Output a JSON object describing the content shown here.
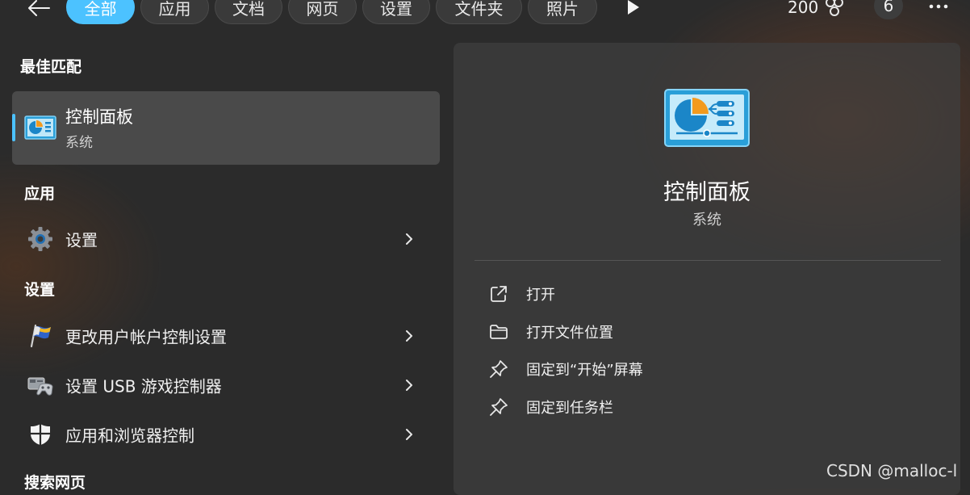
{
  "filters": [
    "全部",
    "应用",
    "文档",
    "网页",
    "设置",
    "文件夹",
    "照片"
  ],
  "header": {
    "points": "200",
    "badge_count": "6"
  },
  "sections": {
    "best_match": "最佳匹配",
    "apps": "应用",
    "settings": "设置",
    "web": "搜索网页"
  },
  "best_match": {
    "title": "控制面板",
    "subtitle": "系统",
    "icon": "control-panel-icon"
  },
  "apps": [
    {
      "label": "设置",
      "icon": "gear-icon"
    }
  ],
  "settings": [
    {
      "label": "更改用户帐户控制设置",
      "icon": "uac-flag-icon"
    },
    {
      "label": "设置 USB 游戏控制器",
      "icon": "game-controller-icon"
    },
    {
      "label": "应用和浏览器控制",
      "icon": "shield-icon"
    }
  ],
  "preview": {
    "title": "控制面板",
    "subtitle": "系统",
    "actions": [
      {
        "label": "打开",
        "icon": "open-external-icon"
      },
      {
        "label": "打开文件位置",
        "icon": "folder-icon"
      },
      {
        "label": "固定到“开始”屏幕",
        "icon": "pin-icon"
      },
      {
        "label": "固定到任务栏",
        "icon": "pin-icon"
      }
    ]
  },
  "watermark": "CSDN @malloc-l",
  "colors": {
    "accent": "#4cc2ff",
    "background": "#2b2b2b",
    "panel": "#3e3e3e",
    "selected": "#4a4a4a"
  }
}
